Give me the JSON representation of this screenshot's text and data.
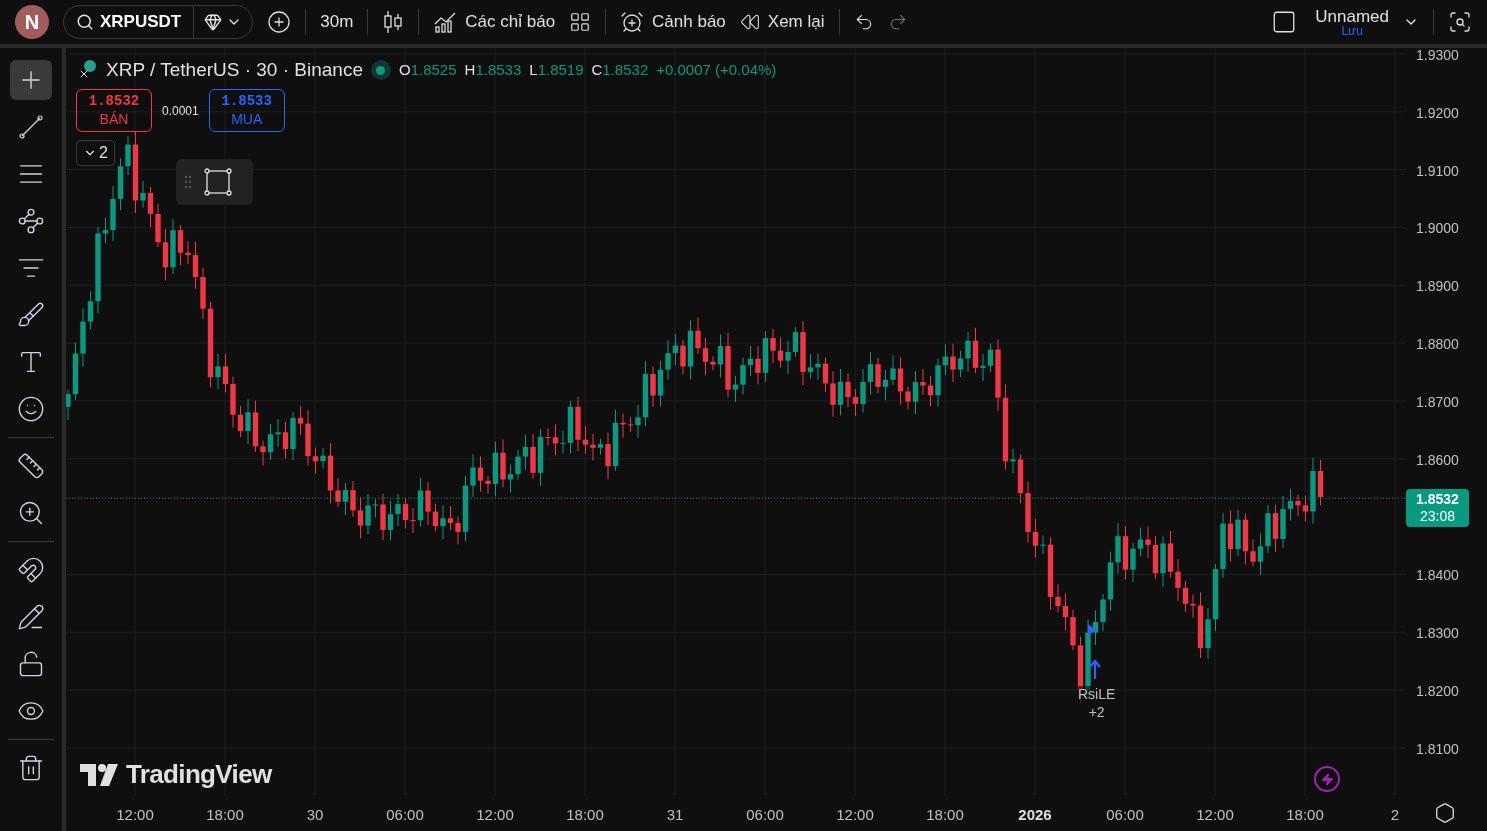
{
  "top_bar": {
    "avatar": "N",
    "symbol": "XRPUSDT",
    "interval": "30m",
    "indicators_label": "Các chỉ báo",
    "alerts_label": "Cảnh báo",
    "replay_label": "Xem lại",
    "layout_name": "Unnamed",
    "save_label": "Lưu"
  },
  "left_toolbar": {
    "groups": [
      [
        {
          "kind": "crosshair",
          "selected": true
        },
        {
          "kind": "trend-line",
          "selected": false
        },
        {
          "kind": "fib",
          "selected": false
        },
        {
          "kind": "pattern",
          "selected": false
        },
        {
          "kind": "forecast",
          "selected": false
        },
        {
          "kind": "brush",
          "selected": false
        },
        {
          "kind": "text",
          "selected": false
        },
        {
          "kind": "emoji",
          "selected": false
        }
      ],
      [
        {
          "kind": "ruler",
          "selected": false
        },
        {
          "kind": "zoom",
          "selected": false
        }
      ],
      [
        {
          "kind": "magnet",
          "selected": false
        },
        {
          "kind": "draw-lock",
          "selected": false
        },
        {
          "kind": "lock",
          "selected": false
        },
        {
          "kind": "hide",
          "selected": false
        }
      ],
      [
        {
          "kind": "trash",
          "selected": false
        }
      ]
    ]
  },
  "chart": {
    "title": "XRP / TetherUS · 30 · Binance",
    "ohlc": [
      {
        "label": "O",
        "value": "1.8525"
      },
      {
        "label": "H",
        "value": "1.8533"
      },
      {
        "label": "L",
        "value": "1.8519"
      },
      {
        "label": "C",
        "value": "1.8532"
      }
    ],
    "change": "+0.0007 (+0.04%)",
    "sell": {
      "price": "1.8532",
      "label": "BÁN"
    },
    "spread": "0.0001",
    "buy": {
      "price": "1.8533",
      "label": "MUA"
    },
    "collapse_count": "2",
    "watermark": "TradingView",
    "signal": {
      "label": "RsiLE",
      "extra": "+2"
    },
    "price_ticks": [
      "1.9300",
      "1.9200",
      "1.9100",
      "1.9000",
      "1.8900",
      "1.8800",
      "1.8700",
      "1.8600",
      "1.8400",
      "1.8300",
      "1.8200",
      "1.8100"
    ],
    "last_price": "1.8532",
    "countdown": "23:08",
    "time_ticks": [
      {
        "label": "12:00",
        "bold": false
      },
      {
        "label": "18:00",
        "bold": false
      },
      {
        "label": "30",
        "bold": false
      },
      {
        "label": "06:00",
        "bold": false
      },
      {
        "label": "12:00",
        "bold": false
      },
      {
        "label": "18:00",
        "bold": false
      },
      {
        "label": "31",
        "bold": false
      },
      {
        "label": "06:00",
        "bold": false
      },
      {
        "label": "12:00",
        "bold": false
      },
      {
        "label": "18:00",
        "bold": false
      },
      {
        "label": "2026",
        "bold": true
      },
      {
        "label": "06:00",
        "bold": false
      },
      {
        "label": "12:00",
        "bold": false
      },
      {
        "label": "18:00",
        "bold": false
      },
      {
        "label": "2",
        "bold": false
      }
    ]
  }
}
